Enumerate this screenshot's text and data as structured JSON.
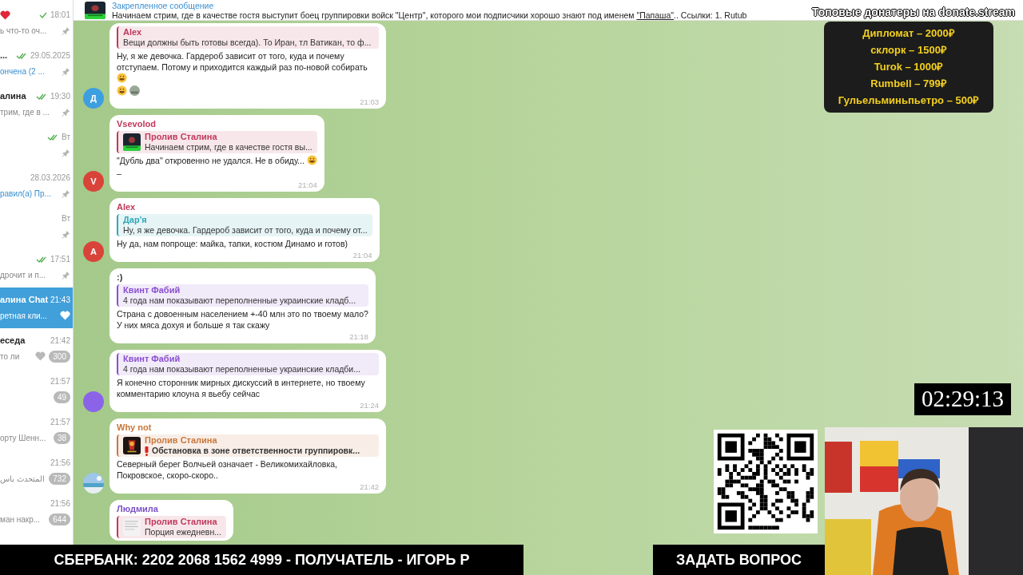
{
  "sidebar": {
    "items": [
      {
        "title_heart": true,
        "time": "18:01",
        "sent": true,
        "preview": "ь что-то оч...",
        "pinned": true,
        "selected": false
      },
      {
        "title": "...",
        "time": "29.05.2025",
        "sent": true,
        "read": true,
        "preview": "ончена (2 ...",
        "highlight": true,
        "pinned": true,
        "selected": false
      },
      {
        "title": "алина",
        "time": "19:30",
        "sent": true,
        "read": true,
        "preview": "трим, где в ...",
        "pinned": true,
        "selected": false
      },
      {
        "time": "Вт",
        "sent": true,
        "read": true,
        "pinned": true,
        "selected": false
      },
      {
        "time": "28.03.2026",
        "preview": "равил(а) Пр...",
        "highlight": true,
        "pinned": true,
        "selected": false
      },
      {
        "time": "Вт",
        "pinned": true,
        "selected": false
      },
      {
        "time": "17:51",
        "sent": true,
        "read": true,
        "preview": "дрочит и п...",
        "pinned": true,
        "selected": false
      },
      {
        "title": "алина Chat",
        "time": "21:43",
        "preview": "ретная кли...",
        "heart": true,
        "selected": true
      },
      {
        "title": "еседа",
        "time": "21:42",
        "preview": "то ли",
        "heart": true,
        "badge": "300",
        "selected": false
      },
      {
        "time": "21:57",
        "badge": "49",
        "selected": false
      },
      {
        "time": "21:57",
        "preview": "орту Шенн...",
        "badge": "38",
        "selected": false
      },
      {
        "time": "21:56",
        "preview": "المتحدث باس",
        "badge": "732",
        "selected": false
      },
      {
        "time": "21:56",
        "preview": "ман накр...",
        "badge": "644",
        "selected": false
      }
    ]
  },
  "pinned": {
    "label": "Закрепленное сообщение",
    "text_before": "Начинаем стрим, где в качестве гостя выступит боец группировки войск \"Центр\", которого мои подписчики хорошо знают под именем ",
    "link": "\"Папаша\"",
    "text_after": ".. Ссылки: 1. Rutub"
  },
  "messages": [
    {
      "reply": {
        "author": "Alex",
        "text": "Вещи должны быть готовы всегда). То Иран, тл Ватикан, то ф...",
        "color": "#c0395a"
      },
      "text": "Ну, я же девочка. Гардероб зависит от того, куда и почему отступаем. Потому и приходится каждый раз по-новой собирать",
      "emoji": true,
      "reactions": [
        {
          "kind": "emoji"
        },
        {
          "kind": "avatar"
        }
      ],
      "time": "21:03",
      "avatar": {
        "kind": "letter",
        "text": "Д",
        "color": "#3e9fe0"
      }
    },
    {
      "sender": {
        "name": "Vsevolod",
        "color": "#c0395a"
      },
      "reply": {
        "author": "Пролив Сталина",
        "text": "Начинаем стрим, где в качестве гостя вы...",
        "color": "#c0395a",
        "thumb": true
      },
      "text": "\"Дубль два\" откровенно не удался. Не в обиду...",
      "emoji": true,
      "extra": "–",
      "time": "21:04",
      "avatar": {
        "kind": "letter",
        "text": "V",
        "color": "#d9443a"
      }
    },
    {
      "sender": {
        "name": "Alex",
        "color": "#c0395a"
      },
      "reply": {
        "author": "Дар'я",
        "text": "Ну, я же девочка. Гардероб зависит от того, куда и почему от...",
        "color": "#2fa8b8"
      },
      "text": "Ну да, нам попроще: майка, тапки, костюм Динамо и готов)",
      "time": "21:04",
      "avatar": {
        "kind": "letter",
        "text": "A",
        "color": "#d9443a"
      }
    },
    {
      "sender": {
        "name": ":)",
        "color": "#333333"
      },
      "reply": {
        "author": "Квинт Фабий",
        "text": "4 года нам показывают переполненные украинские кладб...",
        "color": "#8a4fd0"
      },
      "text": "Страна с довоенным населением +-40 млн это по твоему мало?\nУ них мяса дохуя и больше я так скажу",
      "time": "21:18"
    },
    {
      "reply": {
        "author": "Квинт Фабий",
        "text": "4 года нам показывают переполненные украинские кладби...",
        "color": "#8a4fd0"
      },
      "text": "Я конечно сторонник мирных дискуссий в интернете, но твоему комментарию клоуна я вьебу сейчас",
      "time": "21:24",
      "avatar": {
        "kind": "plain",
        "color": "#8a63e8"
      }
    },
    {
      "sender": {
        "name": "Why not",
        "color": "#c9773a"
      },
      "reply": {
        "author": "Пролив Сталина",
        "text": "Обстановка в зоне ответственности группировк...",
        "color": "#c9773a",
        "thumb": true,
        "alert": true
      },
      "text": "Северный берег Волчьей означает - Великомихайловка, Покровское, скоро-скоро..",
      "time": "21:42"
    },
    {
      "sender": {
        "name": "Людмила",
        "color": "#7a50c8"
      },
      "reply": {
        "author": "Пролив Сталина",
        "text": "Порция ежедневн...",
        "color": "#c0395a",
        "thumb": true
      }
    }
  ],
  "overlay": {
    "donors_title": "Топовые донатеры на donate.stream",
    "donors": [
      "Дипломат – 2000₽",
      "склорк – 1500₽",
      "Turok – 1000₽",
      "Rumbell – 799₽",
      "Гульельминьпьетро – 500₽"
    ],
    "timer": "02:29:13",
    "bank": "СБЕРБАНК: 2202 2068 1562 4999 - ПОЛУЧАТЕЛЬ - ИГОРЬ Р",
    "ask": "ЗАДАТЬ ВОПРОС"
  }
}
